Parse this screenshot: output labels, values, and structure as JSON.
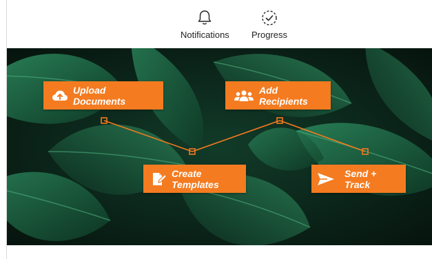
{
  "nav": {
    "notifications_label": "Notifications",
    "progress_label": "Progress"
  },
  "steps": {
    "upload_label": "Upload Documents",
    "recipients_label": "Add Recipients",
    "templates_label": "Create Templates",
    "send_label": "Send + Track"
  },
  "icons": {
    "notifications": "bell-icon",
    "progress": "check-circle-icon",
    "upload": "cloud-upload-icon",
    "recipients": "users-icon",
    "templates": "document-edit-icon",
    "send": "paper-plane-icon"
  },
  "colors": {
    "accent": "#f47b20",
    "leaf_dark": "#0f2a1f",
    "leaf": "#1f6b4a"
  }
}
